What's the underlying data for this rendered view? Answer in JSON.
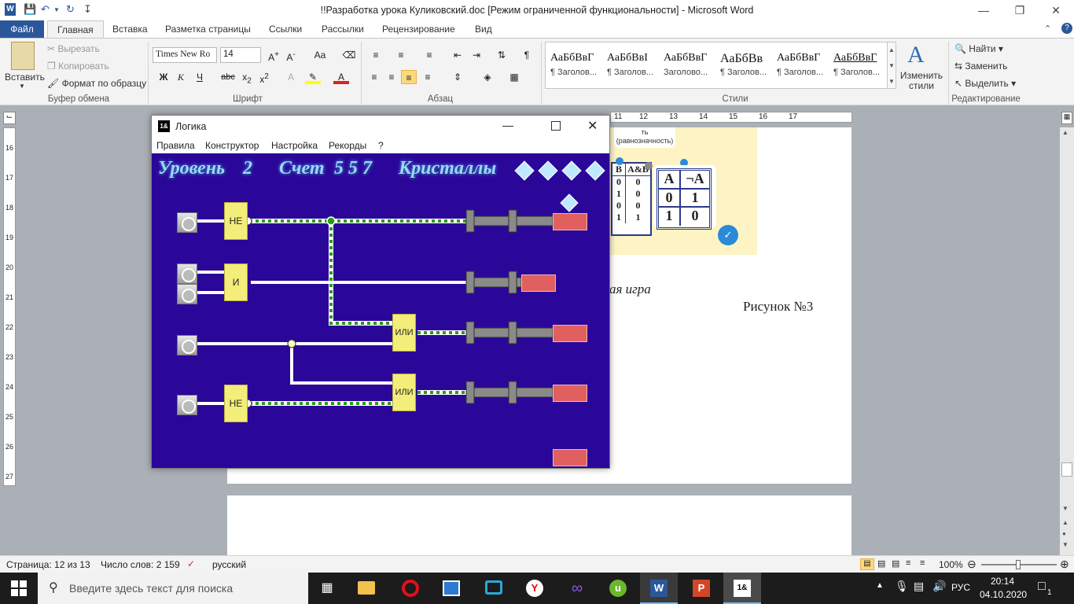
{
  "word": {
    "title": "!!Разработка урока Куликовский.doc [Режим ограниченной функциональности]  -  Microsoft Word",
    "tabs": [
      "Файл",
      "Главная",
      "Вставка",
      "Разметка страницы",
      "Ссылки",
      "Рассылки",
      "Рецензирование",
      "Вид"
    ],
    "clipboard": {
      "paste": "Вставить",
      "cut": "Вырезать",
      "copy": "Копировать",
      "format_painter": "Формат по образцу",
      "label": "Буфер обмена"
    },
    "font": {
      "name": "Times New Ro",
      "size": "14",
      "label": "Шрифт"
    },
    "paragraph_label": "Абзац",
    "styles": {
      "label": "Стили",
      "items": [
        {
          "sample": "АаБбВвГ",
          "name": "¶ Заголов..."
        },
        {
          "sample": "АаБбВвІ",
          "name": "¶ Заголов..."
        },
        {
          "sample": "АаБбВвГ",
          "name": "Заголово..."
        },
        {
          "sample": "АаБбВв",
          "name": "¶ Заголов..."
        },
        {
          "sample": "АаБбВвГ",
          "name": "¶ Заголов..."
        },
        {
          "sample": "АаБбВвГ",
          "name": "¶ Заголов..."
        }
      ],
      "change": "Изменить стили"
    },
    "editing": {
      "find": "Найти",
      "replace": "Заменить",
      "select": "Выделить",
      "label": "Редактирование"
    },
    "ruler_numbers": [
      "11",
      "12",
      "13",
      "14",
      "15",
      "16",
      "17"
    ],
    "vruler_numbers": [
      "16",
      "17",
      "18",
      "19",
      "20",
      "21",
      "22",
      "23",
      "24",
      "25",
      "26",
      "27"
    ],
    "doc": {
      "caption_partial": "ая игра",
      "figure": "Рисунок №3",
      "equiv_label": "(равнозначность)",
      "equiv_top": "ть"
    },
    "truth_and": {
      "headers": [
        "B",
        "A&B"
      ],
      "rows": [
        [
          "0",
          "0"
        ],
        [
          "1",
          "0"
        ],
        [
          "0",
          "0"
        ],
        [
          "1",
          "1"
        ]
      ]
    },
    "truth_not": {
      "headers": [
        "A",
        "¬A"
      ],
      "rows": [
        [
          "0",
          "1"
        ],
        [
          "1",
          "0"
        ]
      ]
    },
    "status": {
      "page": "Страница: 12 из 13",
      "words": "Число слов: 2 159",
      "lang": "русский",
      "zoom": "100%"
    }
  },
  "game": {
    "title": "Логика",
    "menu": [
      "Правила",
      "Конструктор",
      "Настройка",
      "Рекорды",
      "?"
    ],
    "hud": {
      "level_label": "Уровень",
      "level": "2",
      "score_label": "Счет",
      "score": "557",
      "crystals_label": "Кристаллы"
    },
    "gates": {
      "not": "НЕ",
      "and": "И",
      "or": "ИЛИ"
    }
  },
  "taskbar": {
    "search_placeholder": "Введите здесь текст для поиска",
    "lang": "РУС",
    "time": "20:14",
    "date": "04.10.2020",
    "notif": "1"
  }
}
